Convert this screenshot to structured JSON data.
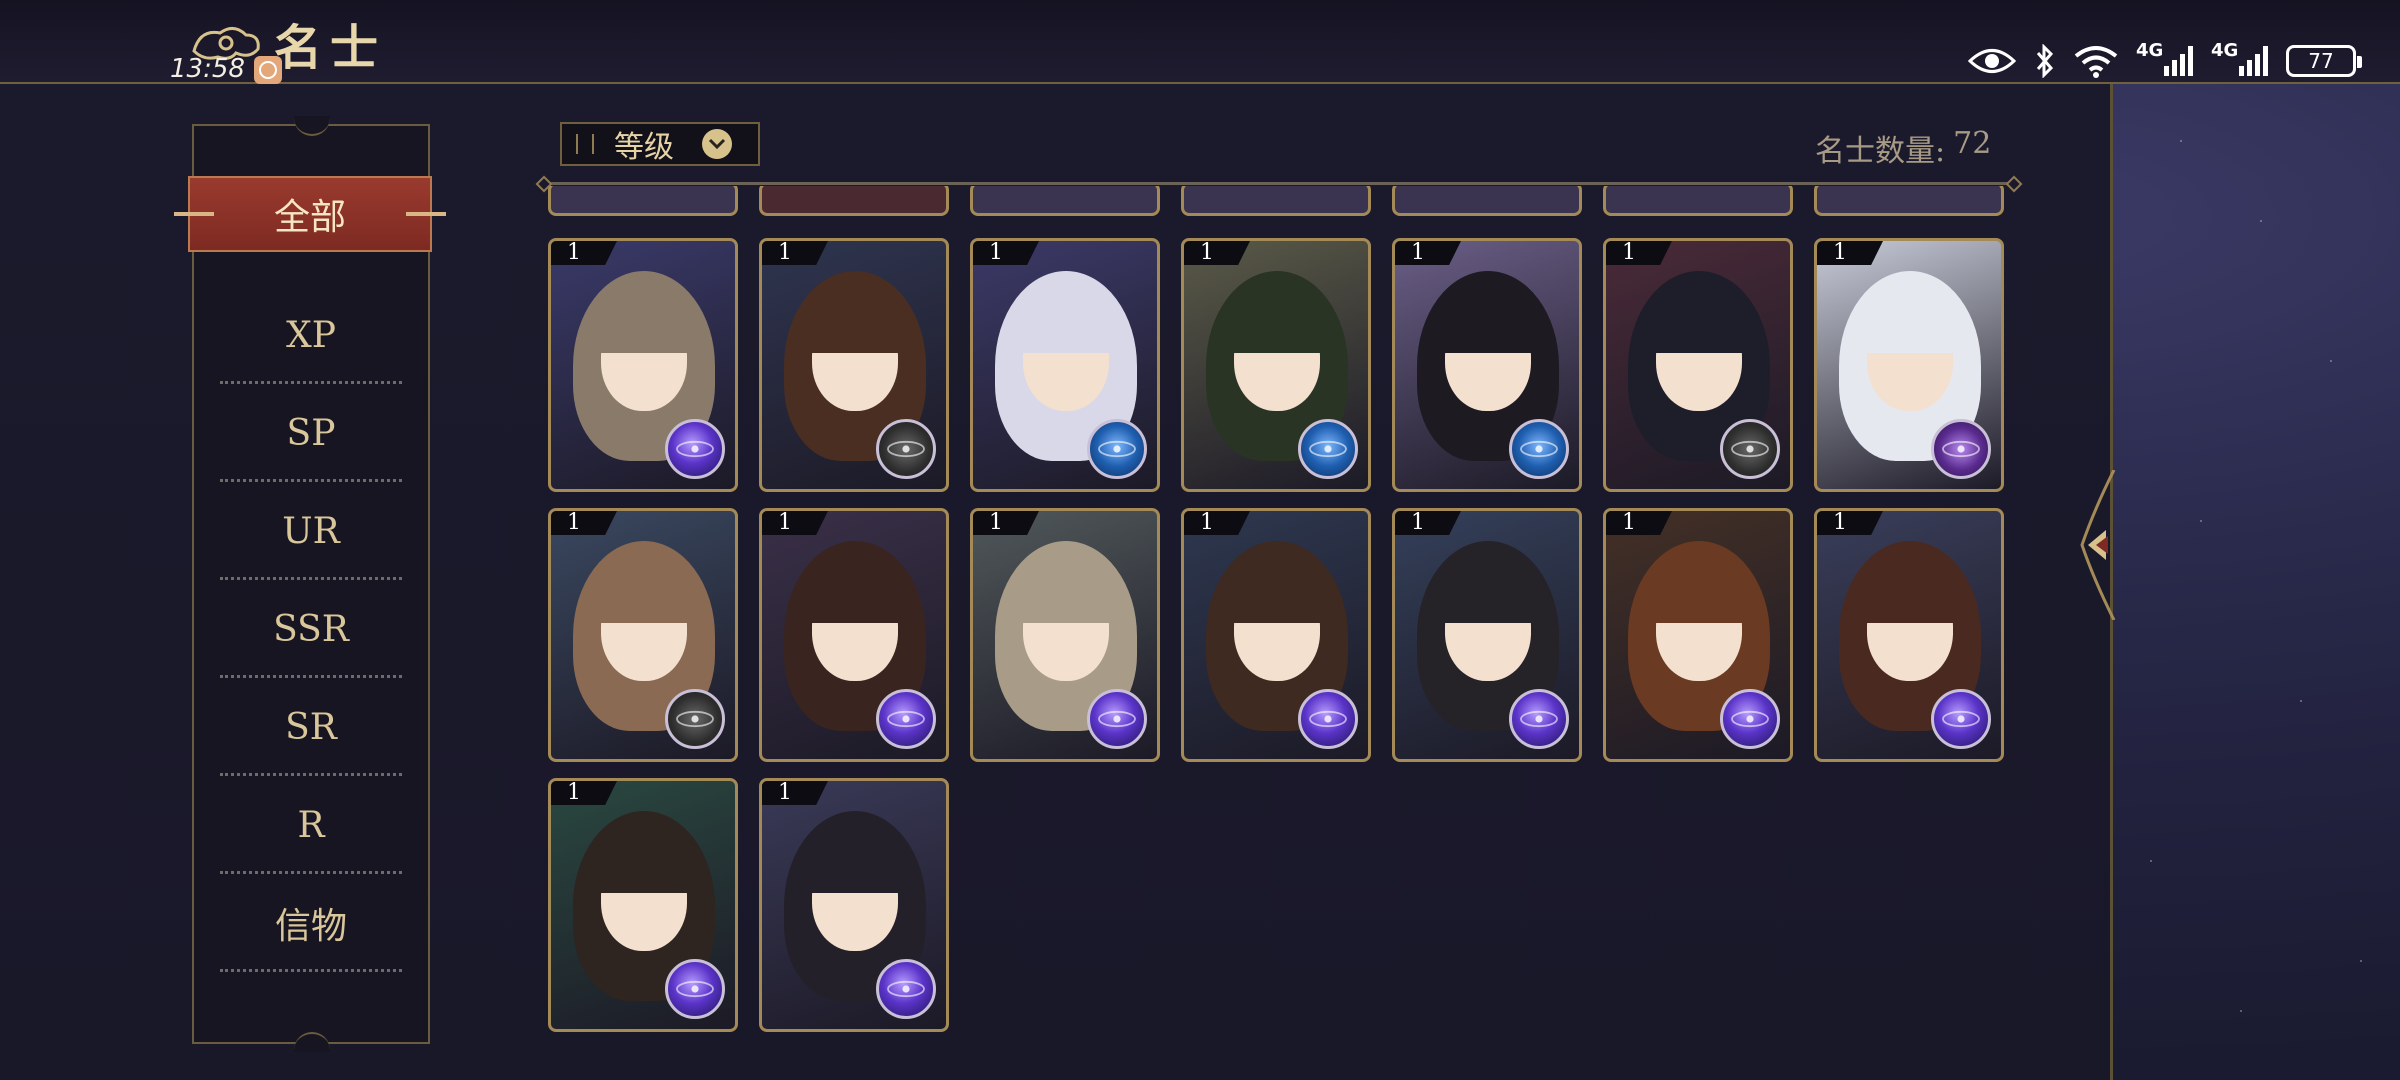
{
  "header": {
    "title": "名士",
    "time": "13:58"
  },
  "status_bar": {
    "network_1": "4G",
    "network_2": "4G",
    "battery": "77"
  },
  "sidebar": {
    "items": [
      {
        "label": "全部",
        "active": true
      },
      {
        "label": "XP"
      },
      {
        "label": "SP"
      },
      {
        "label": "UR"
      },
      {
        "label": "SSR"
      },
      {
        "label": "SR"
      },
      {
        "label": "R"
      },
      {
        "label": "信物"
      }
    ]
  },
  "toolbar": {
    "sort_label": "等级",
    "count_label": "名士数量:",
    "count_value": "72"
  },
  "cards": [
    {
      "level": "1",
      "orb": "purple",
      "bg": "#3a3a6a",
      "hair": "#8a7a6a"
    },
    {
      "level": "1",
      "orb": "gray",
      "bg": "#2f3550",
      "hair": "#4a2e22"
    },
    {
      "level": "1",
      "orb": "blue",
      "bg": "#3c3a68",
      "hair": "#d8d8e8"
    },
    {
      "level": "1",
      "orb": "blue",
      "bg": "#5a5a48",
      "hair": "#2a3424"
    },
    {
      "level": "1",
      "orb": "blue",
      "bg": "#6a5e86",
      "hair": "#1e1a22"
    },
    {
      "level": "1",
      "orb": "gray",
      "bg": "#4a2a38",
      "hair": "#1e1e2a"
    },
    {
      "level": "1",
      "orb": "violet",
      "bg": "#c8ccd8",
      "hair": "#e6e8f0"
    },
    {
      "level": "1",
      "orb": "gray",
      "bg": "#3a4860",
      "hair": "#8a6a52"
    },
    {
      "level": "1",
      "orb": "purple",
      "bg": "#3a3048",
      "hair": "#3a2420"
    },
    {
      "level": "1",
      "orb": "purple",
      "bg": "#50585a",
      "hair": "#a89c88"
    },
    {
      "level": "1",
      "orb": "purple",
      "bg": "#2e3850",
      "hair": "#3e2a20"
    },
    {
      "level": "1",
      "orb": "purple",
      "bg": "#34405a",
      "hair": "#252228"
    },
    {
      "level": "1",
      "orb": "purple",
      "bg": "#443026",
      "hair": "#6a3a22"
    },
    {
      "level": "1",
      "orb": "purple",
      "bg": "#3a3e5a",
      "hair": "#4a2a20"
    },
    {
      "level": "1",
      "orb": "purple",
      "bg": "#2a4840",
      "hair": "#2e2420"
    },
    {
      "level": "1",
      "orb": "purple",
      "bg": "#3a3a58",
      "hair": "#24202a"
    }
  ]
}
